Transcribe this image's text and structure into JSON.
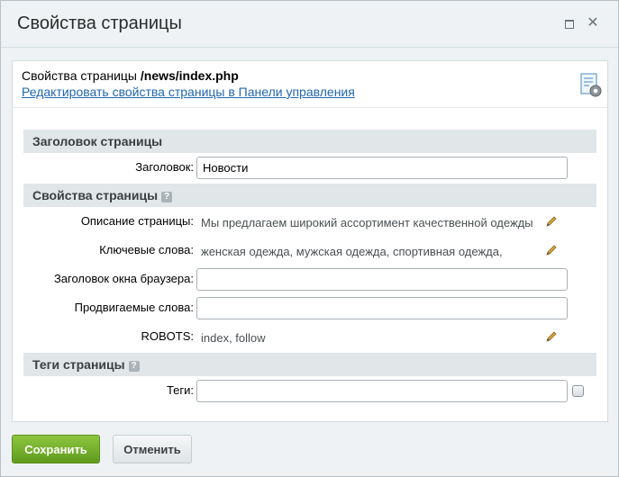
{
  "window": {
    "title": "Свойства страницы"
  },
  "header": {
    "prefix": "Свойства страницы",
    "path": "/news/index.php",
    "link": "Редактировать свойства страницы в Панели управления"
  },
  "sections": {
    "page_title": "Заголовок страницы",
    "page_props": "Свойства страницы",
    "page_tags": "Теги страницы"
  },
  "fields": {
    "title_label": "Заголовок:",
    "title_value": "Новости",
    "description_label": "Описание страницы:",
    "description_value": "Мы предлагаем широкий ассортимент качественной одежды",
    "keywords_label": "Ключевые слова:",
    "keywords_value": "женская одежда, мужская одежда, спортивная одежда,",
    "browser_title_label": "Заголовок окна браузера:",
    "browser_title_value": "",
    "promoted_words_label": "Продвигаемые слова:",
    "promoted_words_value": "",
    "robots_label": "ROBOTS:",
    "robots_value": "index, follow",
    "tags_label": "Теги:",
    "tags_value": ""
  },
  "help_glyph": "?",
  "buttons": {
    "save": "Сохранить",
    "cancel": "Отменить"
  },
  "icons": {
    "maximize": "maximize-icon",
    "close": "close-icon",
    "pencil": "pencil-icon",
    "settings": "page-settings-icon"
  }
}
